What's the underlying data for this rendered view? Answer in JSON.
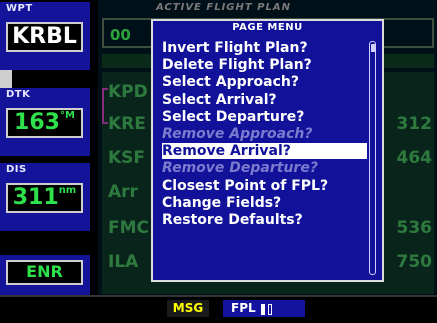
{
  "left_panel": {
    "wpt": {
      "header": "WPT",
      "value": "KRBL"
    },
    "dtk": {
      "header": "DTK",
      "value": "163",
      "unit": "°M"
    },
    "dis": {
      "header": "DIS",
      "value": "311",
      "unit": "nm"
    },
    "mode": {
      "value": "ENR"
    }
  },
  "background": {
    "title": "ACTIVE FLIGHT PLAN",
    "leg_number": "00",
    "waypoints": [
      "KPD",
      "KRE",
      "KSF",
      "Arr",
      "FMC",
      "ILA"
    ],
    "numbers": [
      "312",
      "464",
      "536",
      "750"
    ]
  },
  "menu": {
    "title": "PAGE MENU",
    "items": [
      {
        "label": "Invert Flight Plan?",
        "state": "normal"
      },
      {
        "label": "Delete Flight Plan?",
        "state": "normal"
      },
      {
        "label": "Select Approach?",
        "state": "normal"
      },
      {
        "label": "Select Arrival?",
        "state": "normal"
      },
      {
        "label": "Select Departure?",
        "state": "normal"
      },
      {
        "label": "Remove Approach?",
        "state": "disabled"
      },
      {
        "label": "Remove Arrival?",
        "state": "selected"
      },
      {
        "label": "Remove Departure?",
        "state": "disabled"
      },
      {
        "label": "Closest Point of FPL?",
        "state": "normal"
      },
      {
        "label": "Change Fields?",
        "state": "normal"
      },
      {
        "label": "Restore Defaults?",
        "state": "normal"
      }
    ]
  },
  "status_bar": {
    "msg": "MSG",
    "page": "FPL"
  },
  "colors": {
    "menu_bg": "#11119a",
    "panel_bg": "#14149a",
    "active_green": "#2ee04a",
    "msg_yellow": "#ffff00"
  }
}
